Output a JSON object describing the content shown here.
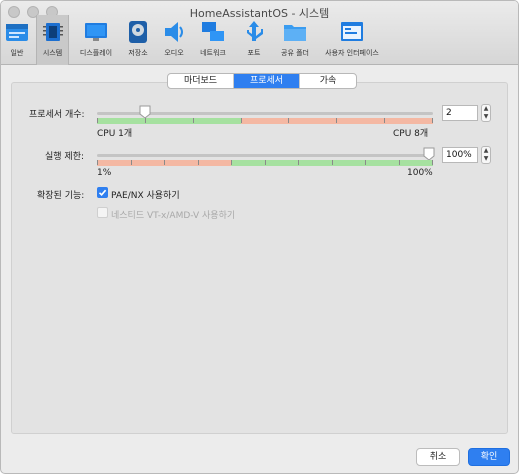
{
  "window": {
    "title": "HomeAssistantOS - 시스템"
  },
  "toolbar": {
    "items": [
      {
        "label": "일반",
        "icon": "general-icon"
      },
      {
        "label": "시스템",
        "icon": "system-chip-icon"
      },
      {
        "label": "디스플레이",
        "icon": "display-monitor-icon"
      },
      {
        "label": "저장소",
        "icon": "storage-disk-icon"
      },
      {
        "label": "오디오",
        "icon": "audio-speaker-icon"
      },
      {
        "label": "네트워크",
        "icon": "network-icon"
      },
      {
        "label": "포트",
        "icon": "ports-usb-icon"
      },
      {
        "label": "공유 폴더",
        "icon": "shared-folder-icon"
      },
      {
        "label": "사용자 인터페이스",
        "icon": "user-interface-icon"
      }
    ],
    "active_index": 1
  },
  "tabs": {
    "items": [
      "마더보드",
      "프로세서",
      "가속"
    ],
    "active_index": 1
  },
  "processor": {
    "count_label": "프로세서 개수:",
    "count_value": "2",
    "min_label": "CPU 1개",
    "max_label": "CPU 8개",
    "slider_min": 1,
    "slider_max": 8,
    "slider_value": 2
  },
  "exec_cap": {
    "label": "실행 제한:",
    "value": "100%",
    "min_label": "1%",
    "max_label": "100%",
    "slider_value_percent": 100
  },
  "features": {
    "label": "확장된 기능:",
    "pae_label": "PAE/NX 사용하기",
    "pae_checked": true,
    "nested_label": "네스티드 VT-x/AMD-V 사용하기",
    "nested_checked": false,
    "nested_enabled": false
  },
  "buttons": {
    "cancel": "취소",
    "ok": "확인"
  },
  "colors": {
    "accent": "#2f7ff0",
    "safe_band": "#a6e1a0",
    "warn_band": "#f4b8a3"
  }
}
